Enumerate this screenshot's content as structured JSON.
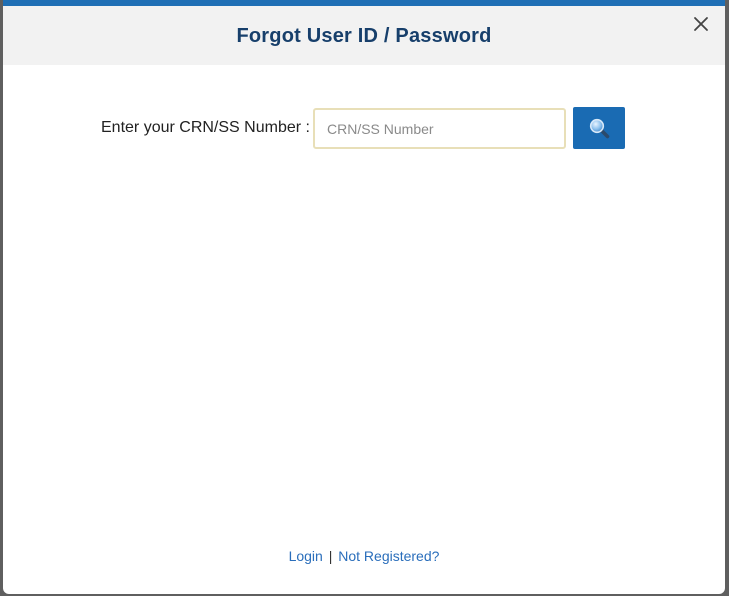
{
  "modal": {
    "title": "Forgot User ID / Password",
    "close_icon": "close-icon"
  },
  "form": {
    "label": "Enter your CRN/SS Number :",
    "input_value": "",
    "input_placeholder": "CRN/SS Number",
    "search_icon": "search-icon"
  },
  "footer": {
    "login_label": "Login",
    "separator": "|",
    "register_label": "Not Registered?"
  },
  "colors": {
    "top_bar": "#1f6fb5",
    "title": "#173f6b",
    "header_bg": "#f2f2f2",
    "search_button": "#1a6bb3",
    "link": "#2a6ebb"
  }
}
